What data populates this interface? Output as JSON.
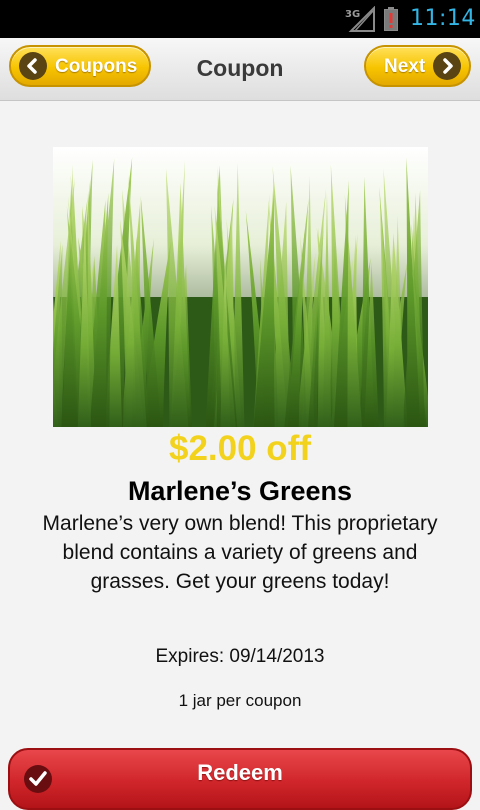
{
  "status_bar": {
    "network_label": "3G",
    "time": "11:14",
    "time_color": "#33b5e5"
  },
  "nav": {
    "title": "Coupon",
    "back_label": "Coupons",
    "next_label": "Next",
    "button_color": "#f7c400"
  },
  "coupon": {
    "image_icon": "grass-photo",
    "discount": "$2.00 off",
    "discount_color": "#f2d21c",
    "name": "Marlene’s Greens",
    "description": "Marlene’s very own blend! This proprietary blend contains a variety of greens and grasses. Get your greens today!",
    "expires": "Expires: 09/14/2013",
    "limit": "1 jar per coupon"
  },
  "actions": {
    "redeem_label": "Redeem",
    "redeem_color": "#d0262b"
  }
}
